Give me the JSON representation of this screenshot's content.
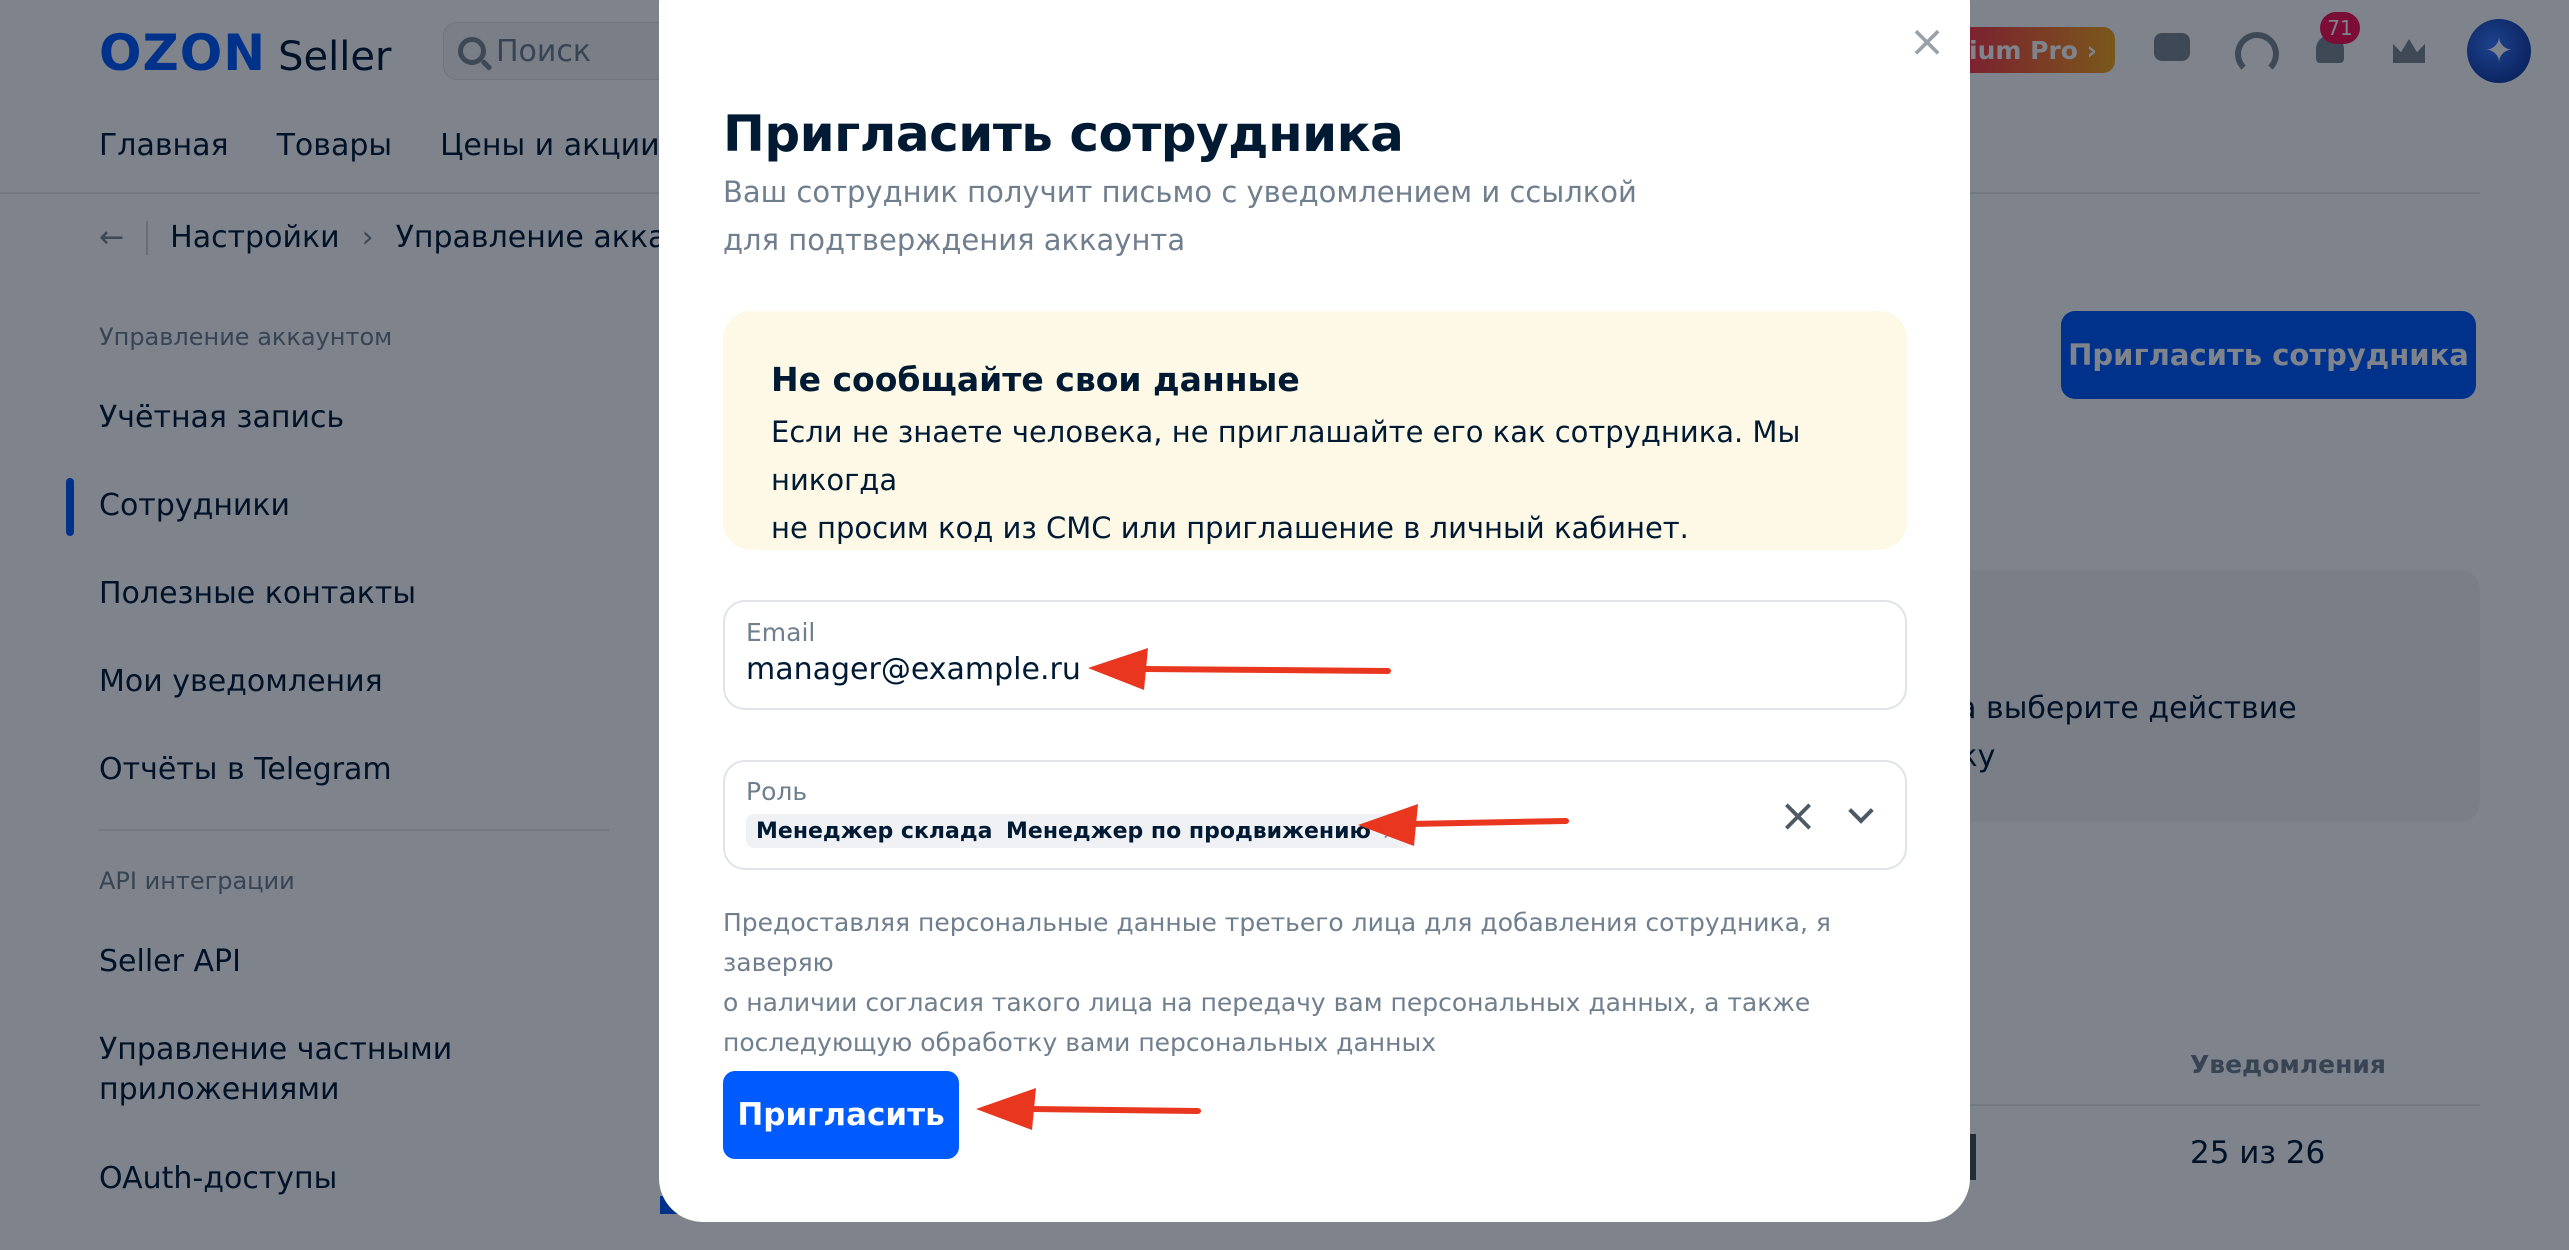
{
  "header": {
    "logo_brand": "OZON",
    "logo_product": "Seller",
    "search_placeholder": "Поиск",
    "premium_label": "mium Pro ›",
    "notifications_count": "71"
  },
  "topnav": [
    "Главная",
    "Товары",
    "Цены и акции"
  ],
  "breadcrumb": {
    "back": "←",
    "items": [
      "Настройки",
      "Управление аккау"
    ],
    "separator": "›"
  },
  "sidebar": {
    "group_account": "Управление аккаунтом",
    "items": [
      "Учётная запись",
      "Сотрудники",
      "Полезные контакты",
      "Мои уведомления",
      "Отчёты в Telegram"
    ],
    "active_item": "Сотрудники",
    "group_api": "API интеграции",
    "api_items": [
      "Seller API",
      "Управление частными",
      "приложениями",
      "OAuth-доступы"
    ]
  },
  "page": {
    "invite_button": "Пригласить сотрудника",
    "info_line1": "ка выберите действие",
    "info_line2": "ику",
    "column_notifications": "Уведомления",
    "notifications_value": "25 из 26"
  },
  "modal": {
    "close_glyph": "×",
    "title": "Пригласить сотрудника",
    "subtitle_line1": "Ваш сотрудник получит письмо с уведомлением и ссылкой",
    "subtitle_line2": "для подтверждения аккаунта",
    "warning_title": "Не сообщайте свои данные",
    "warning_line1": "Если не знаете человека, не приглашайте его как сотрудника. Мы никогда",
    "warning_line2": "не просим код из СМС или приглашение в личный кабинет.",
    "email_label": "Email",
    "email_value": "manager@example.ru",
    "role_label": "Роль",
    "roles": [
      "Менеджер склада",
      "Менеджер по продвижению"
    ],
    "chip_remove_glyph": "×",
    "role_clear_glyph": "×",
    "consent_line1": "Предоставляя персональные данные третьего лица для добавления сотрудника, я заверяю",
    "consent_line2": "о наличии согласия такого лица на передачу вам персональных данных, а также",
    "consent_line3": "последующую обработку вами персональных данных",
    "submit_label": "Пригласить"
  },
  "colors": {
    "brand_blue": "#005bff",
    "annotation_red": "#e8361f",
    "warning_bg": "#fef9e6",
    "notification_badge": "#f91155"
  }
}
